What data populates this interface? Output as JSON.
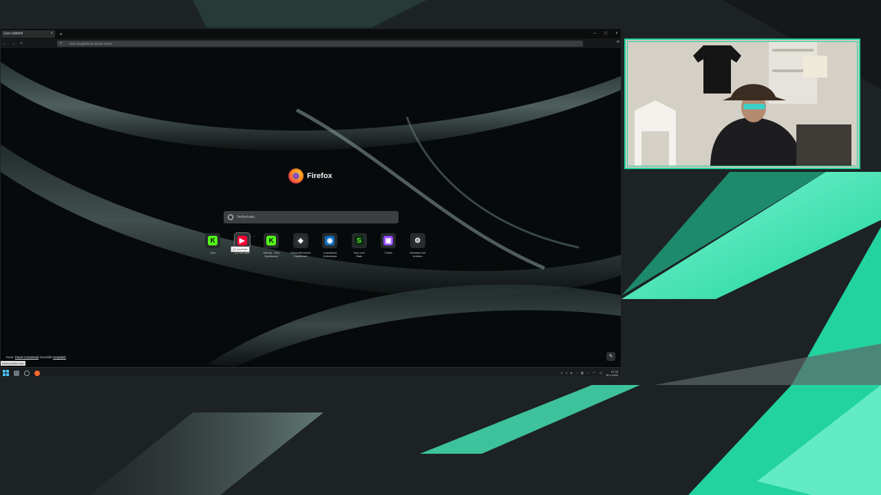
{
  "browser": {
    "tab_title": "Uusi välilehti",
    "tab_close": "×",
    "new_tab": "+",
    "window_controls": [
      "–",
      "□",
      "×"
    ],
    "url": "Hae Googlella tai kirjoita osoite",
    "brand": "Firefox",
    "search_placeholder": "Verkkohaku",
    "shortcuts": [
      {
        "label": "Kick",
        "glyph": "K",
        "color": "#53fc18",
        "fg": "#0b0e0f"
      },
      {
        "label": "(2) YouTube",
        "glyph": "▶",
        "color": "#ff0033",
        "fg": "#ffffff"
      },
      {
        "label": "Stream - Kick\nDashboard",
        "glyph": "K",
        "color": "#53fc18",
        "fg": "#0b0e0f"
      },
      {
        "label": "StreamElements\nDashboard",
        "glyph": "◆",
        "color": "#2e3133",
        "fg": "#ffffff"
      },
      {
        "label": "Lomakkeet\nOutlookista",
        "glyph": "◉",
        "color": "#0f6cbd",
        "fg": "#ffffff"
      },
      {
        "label": "Kick.com\nStats",
        "glyph": "S",
        "color": "#0f2a16",
        "fg": "#53fc18"
      },
      {
        "label": "Twitch",
        "glyph": "▣",
        "color": "#9146ff",
        "fg": "#ffffff"
      },
      {
        "label": "Streamer.bot\nKotisivu",
        "glyph": "⚙",
        "color": "#2a2d30",
        "fg": "#ffffff"
      }
    ],
    "tooltip": "(2) YouTube",
    "credit_prefix": "Kuva:",
    "credit_author": "Pavel Czerwinski",
    "credit_mid": "sivustolla",
    "credit_site": "Unsplash",
    "status_url": "www.youtube.com",
    "edit_icon": "✎"
  },
  "taskbar": {
    "clock_time": "21.34",
    "clock_date": "30.1.2025"
  },
  "colors": {
    "accent": "#22d39f",
    "cam_border": "#22d39f"
  }
}
